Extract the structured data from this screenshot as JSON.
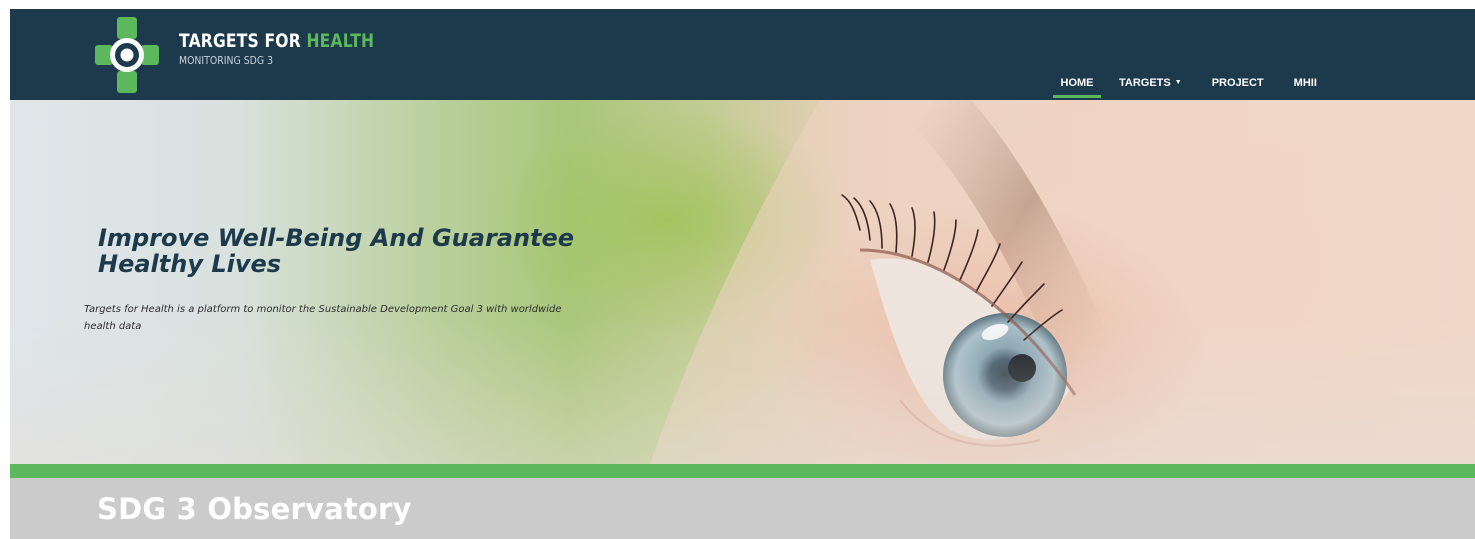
{
  "brand": {
    "title_part1": "TARGETS FOR",
    "title_part2": "HEALTH",
    "subtitle": "MONITORING SDG 3"
  },
  "nav": {
    "items": [
      {
        "label": "HOME",
        "active": true
      },
      {
        "label": "TARGETS",
        "dropdown": true
      },
      {
        "label": "PROJECT"
      },
      {
        "label": "MHII"
      }
    ]
  },
  "hero": {
    "title": "Improve Well-Being And Guarantee Healthy Lives",
    "text": "Targets for Health is a platform to monitor the Sustainable Development Goal 3 with worldwide health data"
  },
  "section": {
    "title": "SDG 3 Observatory"
  },
  "colors": {
    "navbar": "#1d3a4d",
    "accent_green": "#5cb85c",
    "grey_bar": "#cbcbcb"
  }
}
